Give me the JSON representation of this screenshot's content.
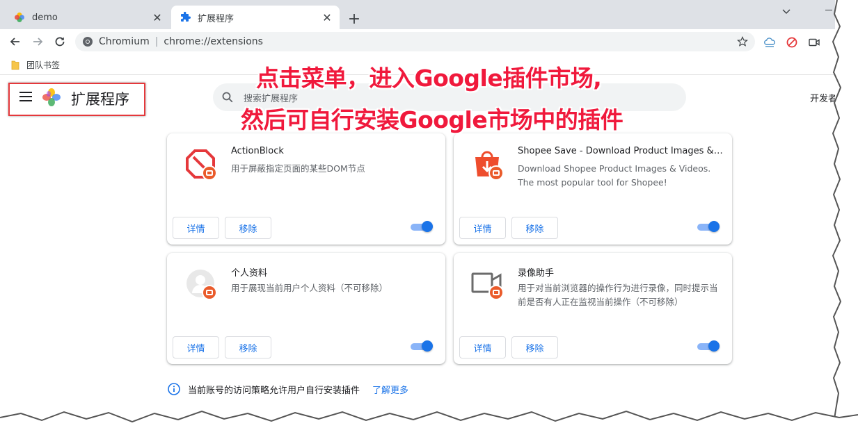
{
  "browser": {
    "tabs": [
      {
        "title": "demo",
        "active": false
      },
      {
        "title": "扩展程序",
        "active": true
      }
    ],
    "close_glyph": "✕",
    "new_tab_glyph": "+",
    "omnibox": {
      "origin": "Chromium",
      "divider": "|",
      "url": "chrome://extensions"
    },
    "bookmark": {
      "label": "团队书签"
    },
    "colors": {
      "tabstrip": "#dee1e6",
      "accent": "#1a73e8"
    }
  },
  "page": {
    "title": "扩展程序",
    "search_placeholder": "搜索扩展程序",
    "dev_mode_label": "开发者模式"
  },
  "annotation": {
    "line1": "点击菜单，进入Google插件市场,",
    "line2": "然后可自行安装Google市场中的插件",
    "color": "#f0193c"
  },
  "extensions": [
    {
      "name": "ActionBlock",
      "description": "用于屏蔽指定页面的某些DOM节点",
      "icon": "block-icon",
      "enabled": true
    },
    {
      "name": "Shopee Save - Download Product Images & Videos",
      "description": "Download Shopee Product Images & Videos. The most popular tool for Shopee!",
      "icon": "shopping-bag-icon",
      "enabled": true
    },
    {
      "name": "个人资料",
      "description": "用于展现当前用户个人资料（不可移除）",
      "icon": "avatar-icon",
      "enabled": true
    },
    {
      "name": "录像助手",
      "description": "用于对当前浏览器的操作行为进行录像，同时提示当前是否有人正在监视当前操作（不可移除）",
      "icon": "video-camera-icon",
      "enabled": true
    }
  ],
  "card_buttons": {
    "details": "详情",
    "remove": "移除"
  },
  "notice": {
    "text": "当前账号的访问策略允许用户自行安装插件",
    "link": "了解更多"
  }
}
